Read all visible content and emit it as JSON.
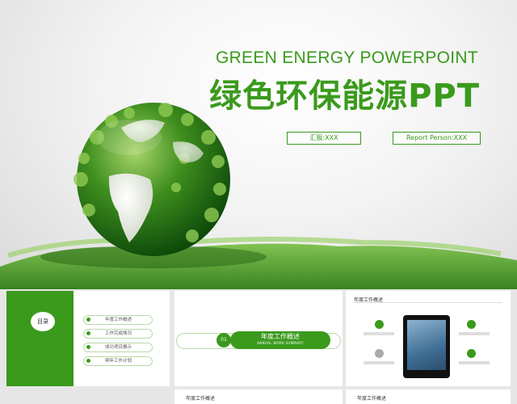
{
  "hero": {
    "title_en": "GREEN ENERGY POWERPOINT",
    "title_cn": "绿色环保能源PPT",
    "reporter": "汇报:XXX",
    "person": "Report Person:XXX"
  },
  "colors": {
    "accent": "#3a9a1c",
    "accent_light": "#b7d9a8",
    "background": "#e6e6e6"
  },
  "thumb1": {
    "circle_label": "目录",
    "menu": [
      "年度工作概述",
      "工作完成情况",
      "成功项目展示",
      "明年工作计划"
    ]
  },
  "thumb2": {
    "number": "01",
    "title": "年度工作概述",
    "subtitle": "ANNUAL WORK SUMMARY"
  },
  "thumb3": {
    "header": "年度工作概述"
  },
  "thumb4": {
    "header": "年度工作概述"
  },
  "thumb5": {
    "header": "年度工作概述"
  }
}
